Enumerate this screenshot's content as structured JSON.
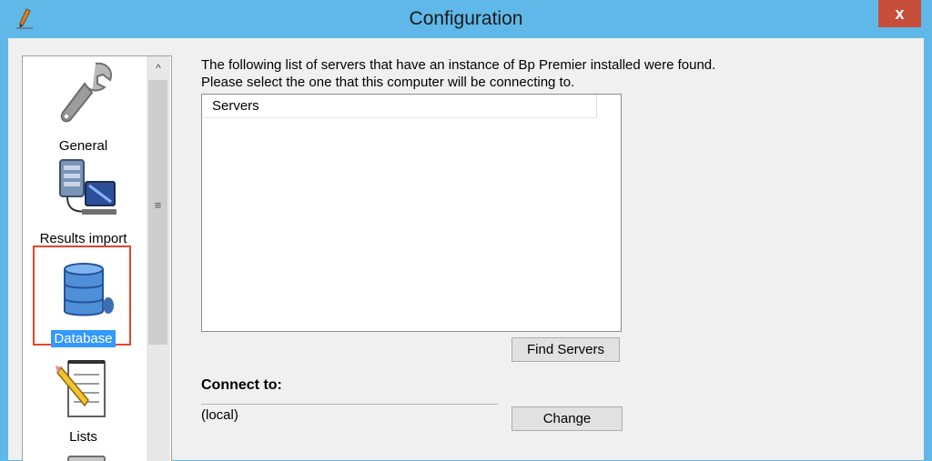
{
  "window": {
    "title": "Configuration",
    "close_label": "x"
  },
  "sidebar": {
    "items": [
      {
        "label": "General",
        "icon": "wrench-icon"
      },
      {
        "label": "Results import",
        "icon": "server-computer-icon"
      },
      {
        "label": "Database",
        "icon": "database-icon",
        "selected": true
      },
      {
        "label": "Lists",
        "icon": "notepad-pencil-icon"
      }
    ],
    "scroll_up": "^",
    "scroll_grip": "≡"
  },
  "main": {
    "description_line1": "The following list of servers that have an instance of Bp Premier installed were found.",
    "description_line2": "Please select the one that this computer will be connecting to.",
    "list_header": "Servers",
    "find_servers_label": "Find Servers",
    "connect_to_label": "Connect to:",
    "connect_value": "(local)",
    "change_label": "Change"
  },
  "colors": {
    "title_bar": "#5fb8e8",
    "close_button": "#c74f3a",
    "selection": "#3399ff",
    "highlight_frame": "#e5452e"
  }
}
